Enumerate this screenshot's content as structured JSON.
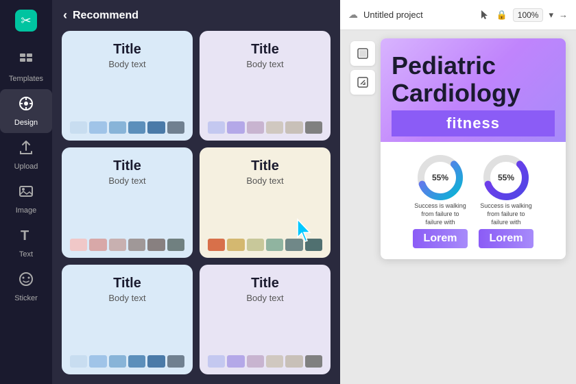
{
  "sidebar": {
    "logo_icon": "✂",
    "items": [
      {
        "label": "Templates",
        "icon": "⊞",
        "active": false,
        "id": "templates"
      },
      {
        "label": "Design",
        "icon": "🎨",
        "active": true,
        "id": "design"
      },
      {
        "label": "Upload",
        "icon": "⬆",
        "active": false,
        "id": "upload"
      },
      {
        "label": "Image",
        "icon": "🖼",
        "active": false,
        "id": "image"
      },
      {
        "label": "Text",
        "icon": "T",
        "active": false,
        "id": "text"
      },
      {
        "label": "Sticker",
        "icon": "●",
        "active": false,
        "id": "sticker"
      }
    ]
  },
  "panel": {
    "back_label": "‹",
    "title": "Recommend",
    "cards": [
      {
        "id": "card1",
        "title": "Title",
        "body": "Body text",
        "bg": "light-blue",
        "swatches": [
          "#c8ddf0",
          "#a0c4e8",
          "#88b4d8",
          "#5c8fbb",
          "#4a7aa8",
          "#708090"
        ]
      },
      {
        "id": "card2",
        "title": "Title",
        "body": "Body text",
        "bg": "light-blue",
        "swatches": [
          "#c4c8f0",
          "#b4a8e8",
          "#c8b4d0",
          "#d0c8c0",
          "#c8c0b8",
          "#808080"
        ]
      },
      {
        "id": "card3",
        "title": "Title",
        "body": "Body text",
        "bg": "light-blue",
        "swatches": [
          "#f0c8c8",
          "#d8a8a8",
          "#c8b0b0",
          "#a09898",
          "#888080",
          "#708080"
        ]
      },
      {
        "id": "card4",
        "title": "Title",
        "body": "Body text",
        "bg": "cream",
        "swatches": [
          "#d8704a",
          "#d4b870",
          "#c8c89a",
          "#90b4a0",
          "#708888",
          "#507070"
        ]
      },
      {
        "id": "card5",
        "title": "Title",
        "body": "Body text",
        "bg": "light-blue",
        "swatches": [
          "#c8ddf0",
          "#a0c4e8",
          "#88b4d8",
          "#5c8fbb",
          "#4a7aa8",
          "#708090"
        ]
      },
      {
        "id": "card6",
        "title": "Title",
        "body": "Body text",
        "bg": "light-blue",
        "swatches": [
          "#c4c8f0",
          "#b4a8e8",
          "#c8b4d0",
          "#d0c8c0",
          "#c8c0b8",
          "#808080"
        ]
      }
    ]
  },
  "canvas": {
    "title": "Untitled project",
    "zoom": "100%",
    "design": {
      "main_title": "Pediatric Cardiology",
      "subtitle": "fitness",
      "chart_percent": "55%",
      "chart_text": "Success is walking from failure to failure with",
      "lorem_label": "Lorem"
    }
  },
  "side_tools": [
    {
      "icon": "🖼",
      "label": "Background"
    },
    {
      "icon": "⊡",
      "label": "Resize"
    }
  ]
}
